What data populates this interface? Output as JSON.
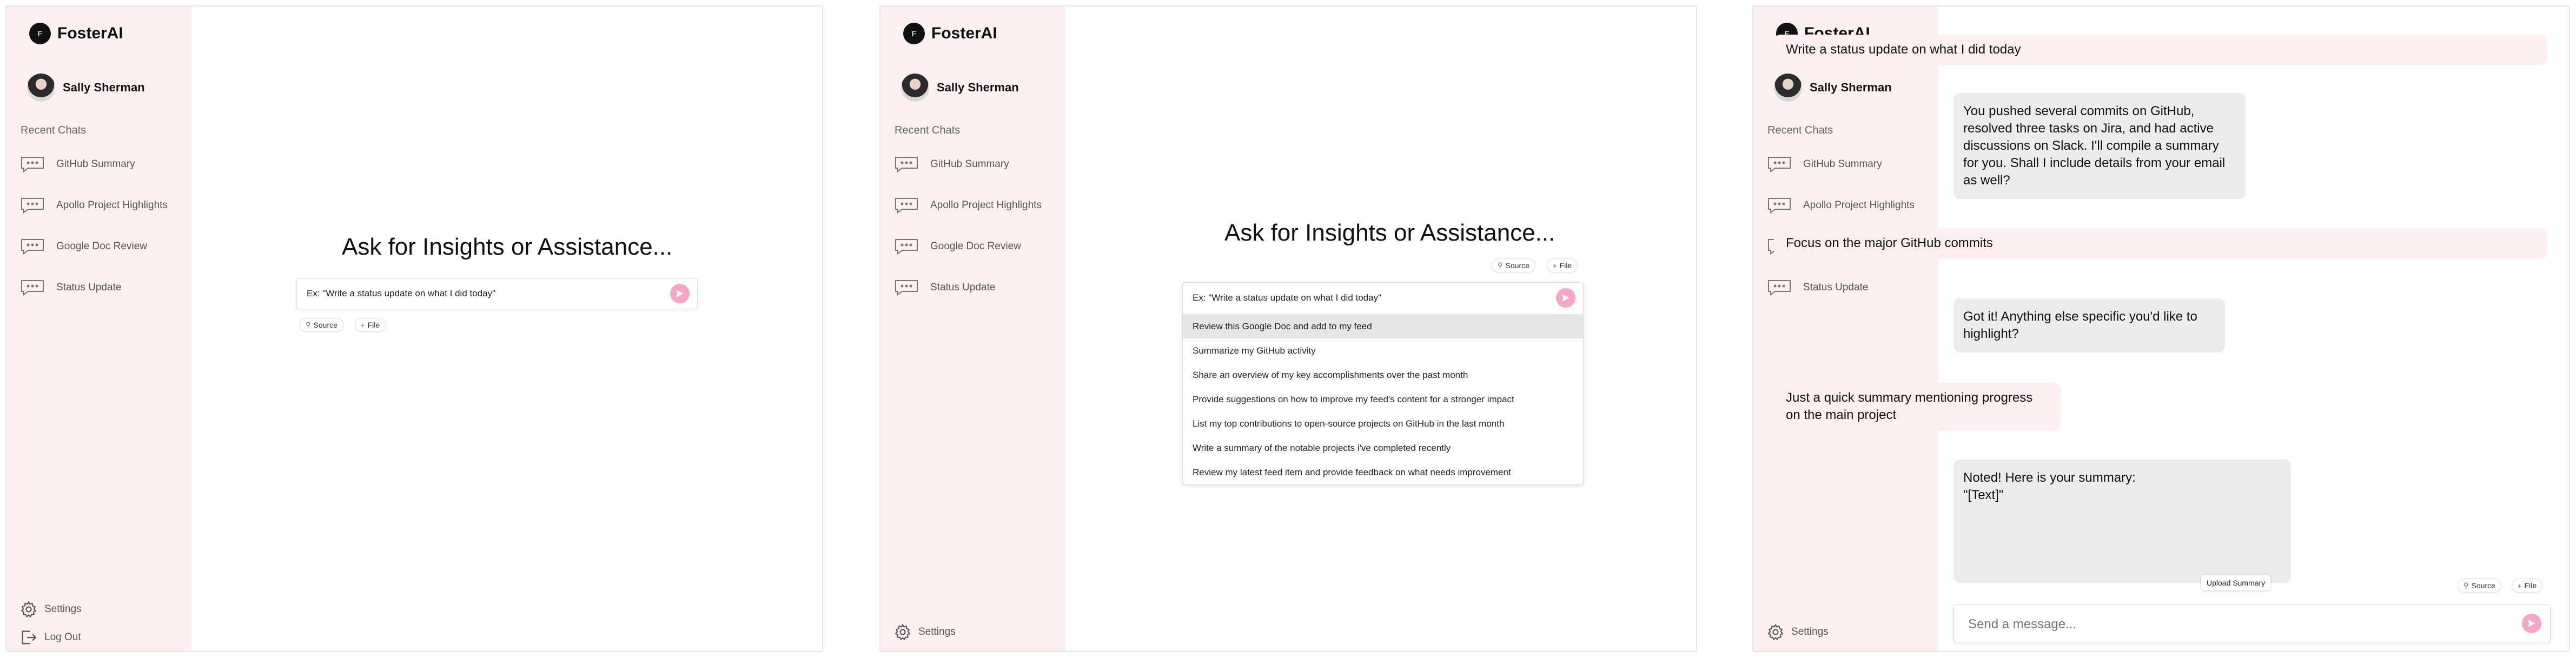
{
  "app": {
    "brand": "FosterAI",
    "logo_text": "F",
    "user_name": "Sally Sherman"
  },
  "sidebar": {
    "section_label": "Recent Chats",
    "chats": [
      "GitHub Summary",
      "Apollo Project Highlights",
      "Google Doc Review",
      "Status Update"
    ],
    "settings_label": "Settings",
    "logout_label": "Log Out"
  },
  "home": {
    "headline": "Ask for Insights or Assistance...",
    "input_placeholder": "Ex: \"Write a status update on what I did today\"",
    "source_label": "Source",
    "file_label": "File"
  },
  "suggestions": [
    "Review this Google Doc and add to my feed",
    "Summarize my GitHub activity",
    "Share an overview of my key accomplishments over the past month",
    "Provide suggestions on how to improve my feed's content for a stronger impact",
    "List my top contributions to open-source projects on GitHub in the last month",
    "Write a summary of the notable projects i've completed recently",
    "Review my latest feed item and provide feedback on what needs improvement"
  ],
  "conversation": {
    "messages": [
      {
        "role": "user",
        "text": "Write a status update on what I did today"
      },
      {
        "role": "bot",
        "text": "You pushed several commits on GitHub, resolved three tasks on Jira, and had active discussions on Slack. I'll compile a summary for you. Shall I include details from your email as well?"
      },
      {
        "role": "user",
        "text": "Focus on the major GitHub commits"
      },
      {
        "role": "bot",
        "text": "Got it! Anything else specific you'd like to highlight?"
      },
      {
        "role": "user",
        "text": "Just a quick summary mentioning progress on the main project"
      },
      {
        "role": "bot",
        "text": "Noted! Here is your summary:\n\"[Text]\""
      }
    ],
    "upload_summary_label": "Upload Summary",
    "message_placeholder": "Send a message..."
  },
  "colors": {
    "sidebar_bg": "#fdf0f2",
    "accent": "#f4a6c6",
    "user_bubble": "#fdeef1",
    "bot_bubble": "#ececec"
  },
  "icons": [
    "chat-bubble-icon",
    "gear-icon",
    "logout-icon",
    "search-icon",
    "plus-icon",
    "send-icon"
  ]
}
